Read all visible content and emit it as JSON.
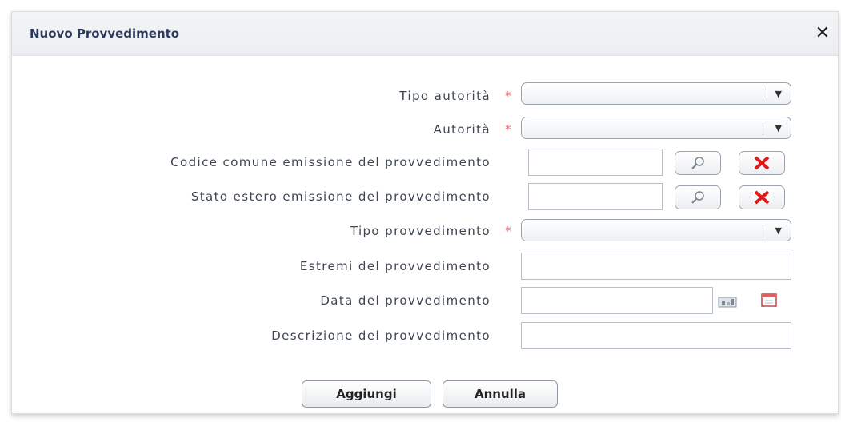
{
  "dialog": {
    "title": "Nuovo Provvedimento",
    "close_symbol": "✕"
  },
  "form": {
    "tipo_autorita_label": "Tipo autorità",
    "autorita_label": "Autorità",
    "codice_comune_label": "Codice comune emissione del provvedimento",
    "stato_estero_label": "Stato estero emissione del provvedimento",
    "tipo_provvedimento_label": "Tipo provvedimento",
    "estremi_label": "Estremi del provvedimento",
    "data_label": "Data del provvedimento",
    "descrizione_label": "Descrizione del provvedimento",
    "required_mark": "*"
  },
  "buttons": {
    "add": "Aggiungi",
    "cancel": "Annulla"
  }
}
